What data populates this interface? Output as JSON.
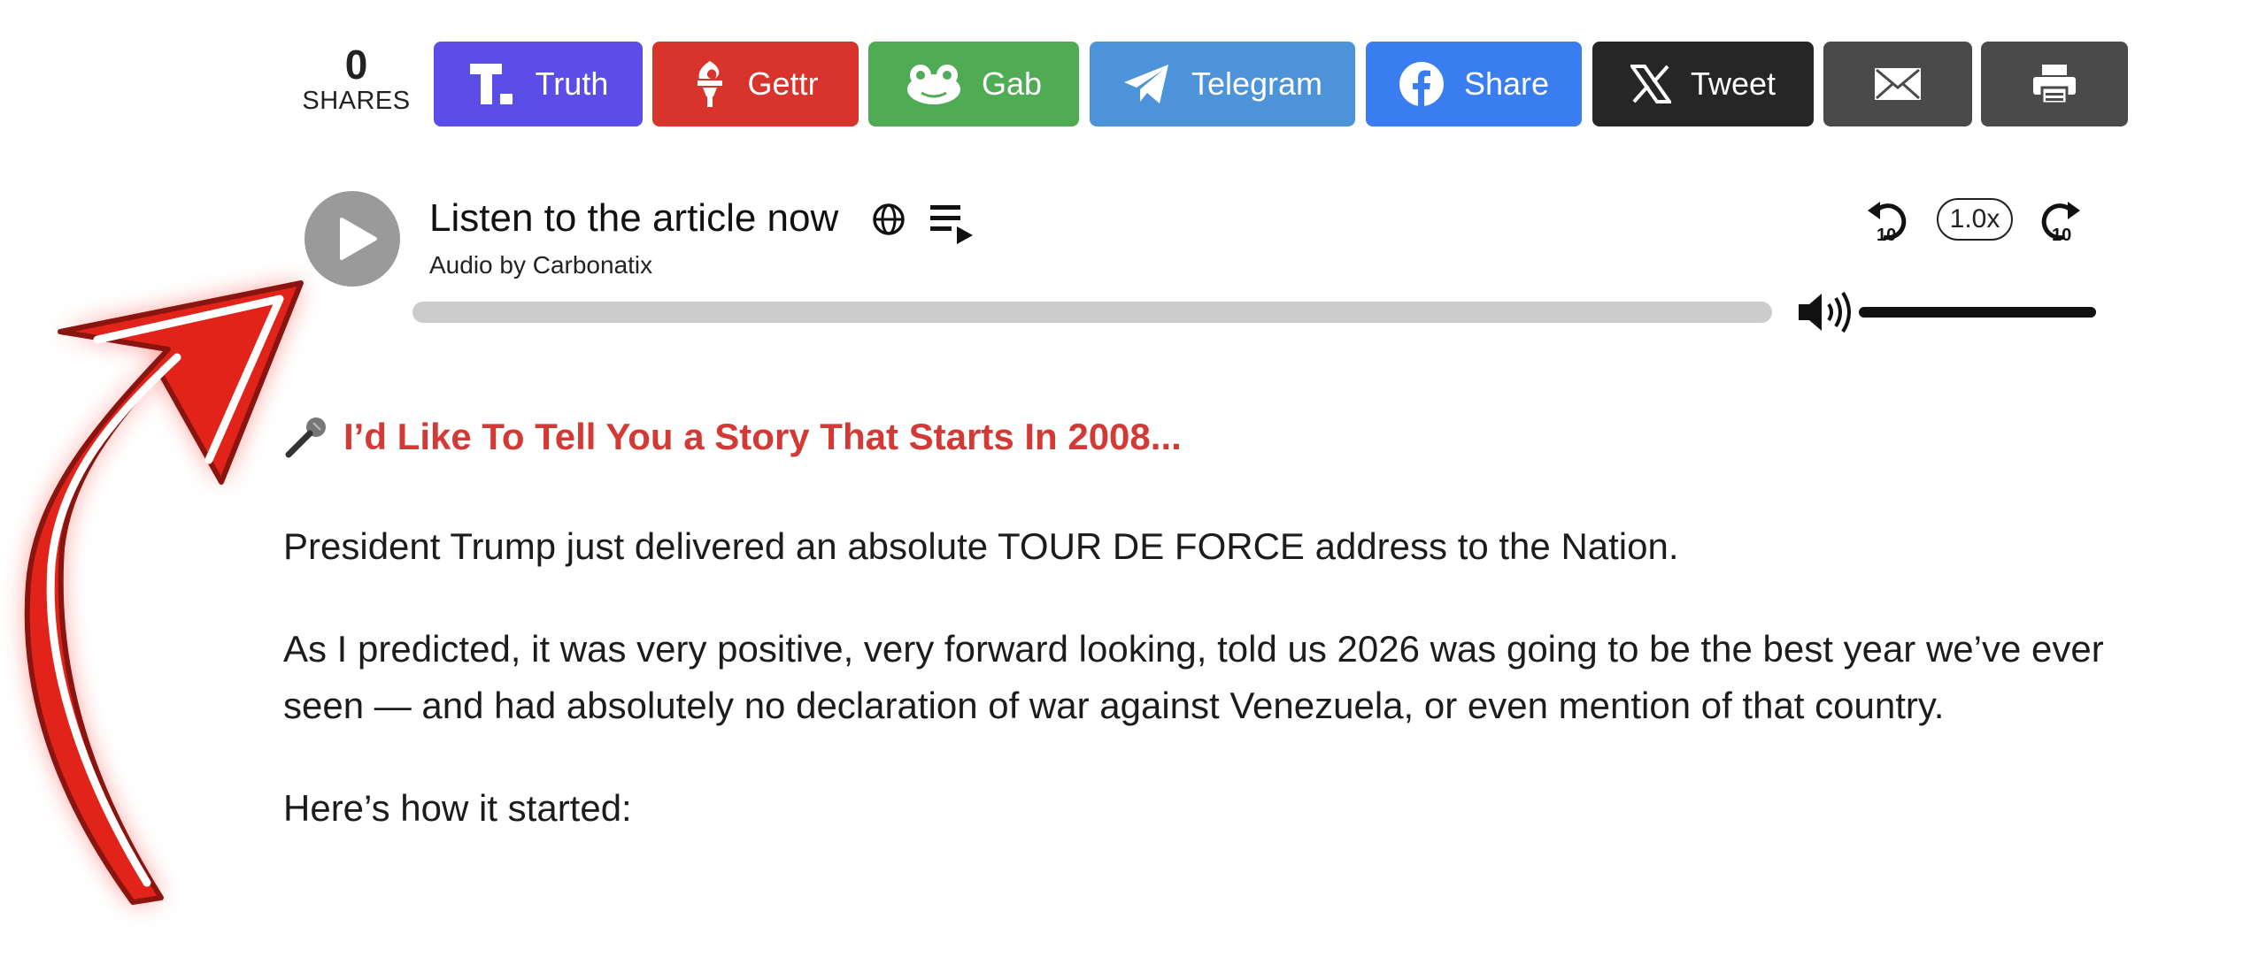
{
  "share_bar": {
    "count": "0",
    "count_label": "SHARES",
    "buttons": [
      {
        "label": "Truth",
        "icon": "truth-social-icon",
        "color": "#5a4de8"
      },
      {
        "label": "Gettr",
        "icon": "gettr-icon",
        "color": "#d8342b"
      },
      {
        "label": "Gab",
        "icon": "gab-frog-icon",
        "color": "#4fab54"
      },
      {
        "label": "Telegram",
        "icon": "telegram-icon",
        "color": "#4c93d9"
      },
      {
        "label": "Share",
        "icon": "facebook-icon",
        "color": "#3a7df0"
      },
      {
        "label": "Tweet",
        "icon": "x-icon",
        "color": "#262626"
      },
      {
        "label": "",
        "icon": "email-icon",
        "color": "#4a4a4a"
      },
      {
        "label": "",
        "icon": "print-icon",
        "color": "#4a4a4a"
      }
    ]
  },
  "player": {
    "title": "Listen to the article now",
    "subtitle": "Audio by Carbonatix",
    "speed": "1.0x",
    "progress": 0,
    "volume": 1.0,
    "icons": [
      "play-icon",
      "globe-icon",
      "playlist-icon",
      "rewind-10-icon",
      "forward-10-icon",
      "volume-icon"
    ]
  },
  "article": {
    "headline_icon": "microphone-icon",
    "headline": "I’d Like To Tell You a Story That Starts In 2008...",
    "paragraphs": [
      "President Trump just delivered an absolute TOUR DE FORCE address to the Nation.",
      "As I predicted, it was very positive, very forward looking, told us 2026 was going to be the best year we’ve ever seen — and had absolutely no declaration of war against Venezuela, or even mention of that country.",
      "Here’s how it started:"
    ]
  },
  "overlay": {
    "icon": "red-arrow-annotation",
    "color": "#e2231a"
  }
}
